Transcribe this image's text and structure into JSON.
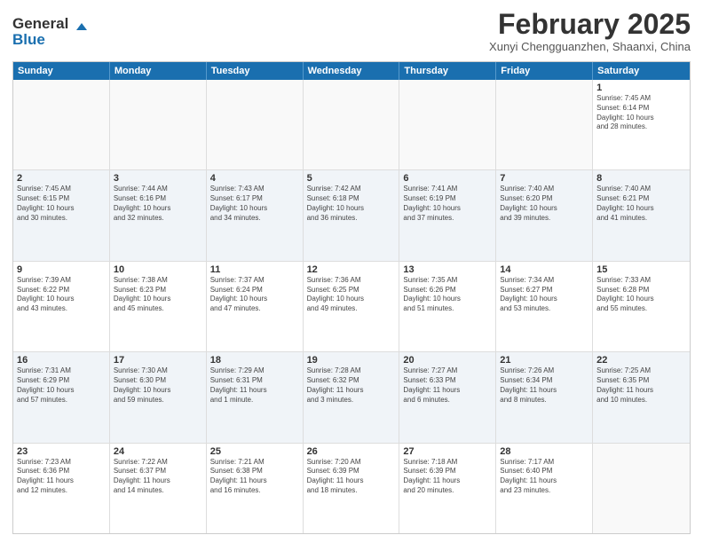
{
  "logo": {
    "line1": "General",
    "line2": "Blue"
  },
  "title": "February 2025",
  "location": "Xunyi Chengguanzhen, Shaanxi, China",
  "weekdays": [
    "Sunday",
    "Monday",
    "Tuesday",
    "Wednesday",
    "Thursday",
    "Friday",
    "Saturday"
  ],
  "weeks": [
    [
      {
        "day": "",
        "info": ""
      },
      {
        "day": "",
        "info": ""
      },
      {
        "day": "",
        "info": ""
      },
      {
        "day": "",
        "info": ""
      },
      {
        "day": "",
        "info": ""
      },
      {
        "day": "",
        "info": ""
      },
      {
        "day": "1",
        "info": "Sunrise: 7:45 AM\nSunset: 6:14 PM\nDaylight: 10 hours\nand 28 minutes."
      }
    ],
    [
      {
        "day": "2",
        "info": "Sunrise: 7:45 AM\nSunset: 6:15 PM\nDaylight: 10 hours\nand 30 minutes."
      },
      {
        "day": "3",
        "info": "Sunrise: 7:44 AM\nSunset: 6:16 PM\nDaylight: 10 hours\nand 32 minutes."
      },
      {
        "day": "4",
        "info": "Sunrise: 7:43 AM\nSunset: 6:17 PM\nDaylight: 10 hours\nand 34 minutes."
      },
      {
        "day": "5",
        "info": "Sunrise: 7:42 AM\nSunset: 6:18 PM\nDaylight: 10 hours\nand 36 minutes."
      },
      {
        "day": "6",
        "info": "Sunrise: 7:41 AM\nSunset: 6:19 PM\nDaylight: 10 hours\nand 37 minutes."
      },
      {
        "day": "7",
        "info": "Sunrise: 7:40 AM\nSunset: 6:20 PM\nDaylight: 10 hours\nand 39 minutes."
      },
      {
        "day": "8",
        "info": "Sunrise: 7:40 AM\nSunset: 6:21 PM\nDaylight: 10 hours\nand 41 minutes."
      }
    ],
    [
      {
        "day": "9",
        "info": "Sunrise: 7:39 AM\nSunset: 6:22 PM\nDaylight: 10 hours\nand 43 minutes."
      },
      {
        "day": "10",
        "info": "Sunrise: 7:38 AM\nSunset: 6:23 PM\nDaylight: 10 hours\nand 45 minutes."
      },
      {
        "day": "11",
        "info": "Sunrise: 7:37 AM\nSunset: 6:24 PM\nDaylight: 10 hours\nand 47 minutes."
      },
      {
        "day": "12",
        "info": "Sunrise: 7:36 AM\nSunset: 6:25 PM\nDaylight: 10 hours\nand 49 minutes."
      },
      {
        "day": "13",
        "info": "Sunrise: 7:35 AM\nSunset: 6:26 PM\nDaylight: 10 hours\nand 51 minutes."
      },
      {
        "day": "14",
        "info": "Sunrise: 7:34 AM\nSunset: 6:27 PM\nDaylight: 10 hours\nand 53 minutes."
      },
      {
        "day": "15",
        "info": "Sunrise: 7:33 AM\nSunset: 6:28 PM\nDaylight: 10 hours\nand 55 minutes."
      }
    ],
    [
      {
        "day": "16",
        "info": "Sunrise: 7:31 AM\nSunset: 6:29 PM\nDaylight: 10 hours\nand 57 minutes."
      },
      {
        "day": "17",
        "info": "Sunrise: 7:30 AM\nSunset: 6:30 PM\nDaylight: 10 hours\nand 59 minutes."
      },
      {
        "day": "18",
        "info": "Sunrise: 7:29 AM\nSunset: 6:31 PM\nDaylight: 11 hours\nand 1 minute."
      },
      {
        "day": "19",
        "info": "Sunrise: 7:28 AM\nSunset: 6:32 PM\nDaylight: 11 hours\nand 3 minutes."
      },
      {
        "day": "20",
        "info": "Sunrise: 7:27 AM\nSunset: 6:33 PM\nDaylight: 11 hours\nand 6 minutes."
      },
      {
        "day": "21",
        "info": "Sunrise: 7:26 AM\nSunset: 6:34 PM\nDaylight: 11 hours\nand 8 minutes."
      },
      {
        "day": "22",
        "info": "Sunrise: 7:25 AM\nSunset: 6:35 PM\nDaylight: 11 hours\nand 10 minutes."
      }
    ],
    [
      {
        "day": "23",
        "info": "Sunrise: 7:23 AM\nSunset: 6:36 PM\nDaylight: 11 hours\nand 12 minutes."
      },
      {
        "day": "24",
        "info": "Sunrise: 7:22 AM\nSunset: 6:37 PM\nDaylight: 11 hours\nand 14 minutes."
      },
      {
        "day": "25",
        "info": "Sunrise: 7:21 AM\nSunset: 6:38 PM\nDaylight: 11 hours\nand 16 minutes."
      },
      {
        "day": "26",
        "info": "Sunrise: 7:20 AM\nSunset: 6:39 PM\nDaylight: 11 hours\nand 18 minutes."
      },
      {
        "day": "27",
        "info": "Sunrise: 7:18 AM\nSunset: 6:39 PM\nDaylight: 11 hours\nand 20 minutes."
      },
      {
        "day": "28",
        "info": "Sunrise: 7:17 AM\nSunset: 6:40 PM\nDaylight: 11 hours\nand 23 minutes."
      },
      {
        "day": "",
        "info": ""
      }
    ]
  ]
}
